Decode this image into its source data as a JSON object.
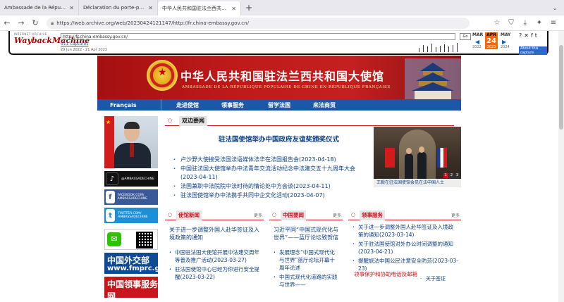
{
  "browser": {
    "tabs": [
      {
        "title": "Ambassade de la République Popul"
      },
      {
        "title": "Déclaration du porte-parole de l'Amb"
      },
      {
        "title": "中华人民共和国驻法兰西共和国大使馆"
      }
    ],
    "url": "https://web.archive.org/web/20230424121147/http://fr.china-embassy.gov.cn/"
  },
  "wayback": {
    "logo_small": "INTERNET ARCHIVE",
    "logo_main": "WaybackMachine",
    "url_input": "http://fr.china-embassy.gov.cn/",
    "go_label": "Go",
    "captures_label": "911 captures",
    "range_label": "29 Jun 2022 - 21 Apr 2023",
    "month_prev": "MAR",
    "month_cur": "APR",
    "month_next": "MAY",
    "day": "24",
    "year_cur": "2023",
    "year_prev": "2022",
    "year_next": "2024",
    "about_label": "About this capture"
  },
  "banner": {
    "title": "中华人民共和国驻法兰西共和国大使馆",
    "subtitle": "AMBASSADE DE LA RÉPUBLIQUE POPULAIRE DE CHINE EN RÉPUBLIQUE FRANÇAISE"
  },
  "menu": {
    "francais": "Français",
    "items": [
      "走进使馆",
      "领事服务",
      "留学法国",
      "来法商贸"
    ]
  },
  "sidebar": {
    "tiktok": "@AMBASSADECHINE",
    "facebook": "FACEBOOK.COM/ AMBASSADECHINE",
    "twitter": "TWITTER.COM/ AMBASSADECHINE",
    "mfa_cn": "中国外交部",
    "mfa_url": "www.fmprc.gov.cn",
    "consular_cn": "中国领事服务网"
  },
  "news": {
    "tab": "双边要闻",
    "headline": "驻法国使馆举办中国政府友谊奖颁奖仪式",
    "items": [
      "卢沙野大使接受法国法语媒体法华在法国报告会(2023-04-18)",
      "中国驻法国大使馆举办中法青年交流活动纪念中法建交五十九周年大会(2023-04-11)",
      "法国兼职中法院院中法时待的情论处中方会谈(2023-04-11)",
      "驻法国使馆举办中法携手共同中企文化活动(2023-04-07)"
    ],
    "photo_caption": "王毅在驻法国使馆会见在法中国人士",
    "photo_pages": [
      "1",
      "2",
      "3"
    ]
  },
  "boxes": [
    {
      "title": "使馆新闻",
      "more": "更多",
      "lead": "关于进一步调整外国人赴华签证及入境政策的通知",
      "items": [
        "中国驻法国大使馆开展中法建交周年等普及推广活动(2023-03-27)",
        "驻法国使馆中心已经为你进行安全提醒(2023-03-22)"
      ]
    },
    {
      "title": "中国要闻",
      "more": "更多",
      "lead": "习近平同“中国式现代化与世界”——蓝厅论坛致贺信",
      "items": [
        "发展理念“中国式现代化与世界”蓝厅论坛开幕十周年论述",
        "中国式现代化道路的实践与世界——"
      ]
    },
    {
      "title": "领事服务",
      "more": "更多",
      "items": [
        "关于进一步调整外国人赴华签证及入境政策的通知(2023-03-14)",
        "关于驻法国使馆对外办公时间调整的通知(2023-04-21)",
        "提醒旅法中国公民注意安全防范(2023-03-23)"
      ]
    }
  ],
  "notice": {
    "red_text": "领事保护和协助电话及邮箱",
    "link": "关于签证"
  },
  "colors": {
    "banner_red": "#c01b1b",
    "menu_blue": "#1d58a8",
    "link_blue": "#0b3e86",
    "accent_red": "#c8161d"
  }
}
